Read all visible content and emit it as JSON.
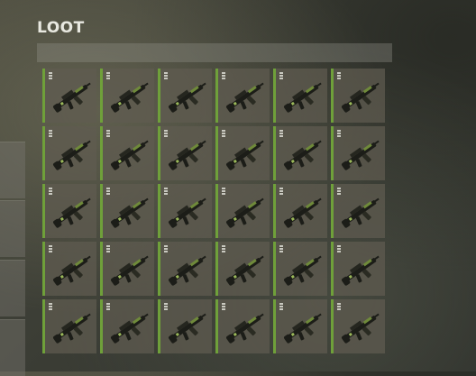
{
  "panel": {
    "title": "LOOT"
  },
  "inventory": {
    "rows": 5,
    "columns": 6,
    "slots": [
      {
        "item_icon": "assault-rifle-icon",
        "rarity_color": "#6fa03a"
      },
      {
        "item_icon": "assault-rifle-icon",
        "rarity_color": "#6fa03a"
      },
      {
        "item_icon": "assault-rifle-icon",
        "rarity_color": "#6fa03a"
      },
      {
        "item_icon": "assault-rifle-icon",
        "rarity_color": "#6fa03a"
      },
      {
        "item_icon": "assault-rifle-icon",
        "rarity_color": "#6fa03a"
      },
      {
        "item_icon": "assault-rifle-icon",
        "rarity_color": "#6fa03a"
      },
      {
        "item_icon": "assault-rifle-icon",
        "rarity_color": "#6fa03a"
      },
      {
        "item_icon": "assault-rifle-icon",
        "rarity_color": "#6fa03a"
      },
      {
        "item_icon": "assault-rifle-icon",
        "rarity_color": "#6fa03a"
      },
      {
        "item_icon": "assault-rifle-icon",
        "rarity_color": "#6fa03a"
      },
      {
        "item_icon": "assault-rifle-icon",
        "rarity_color": "#6fa03a"
      },
      {
        "item_icon": "assault-rifle-icon",
        "rarity_color": "#6fa03a"
      },
      {
        "item_icon": "assault-rifle-icon",
        "rarity_color": "#6fa03a"
      },
      {
        "item_icon": "assault-rifle-icon",
        "rarity_color": "#6fa03a"
      },
      {
        "item_icon": "assault-rifle-icon",
        "rarity_color": "#6fa03a"
      },
      {
        "item_icon": "assault-rifle-icon",
        "rarity_color": "#6fa03a"
      },
      {
        "item_icon": "assault-rifle-icon",
        "rarity_color": "#6fa03a"
      },
      {
        "item_icon": "assault-rifle-icon",
        "rarity_color": "#6fa03a"
      },
      {
        "item_icon": "assault-rifle-icon",
        "rarity_color": "#6fa03a"
      },
      {
        "item_icon": "assault-rifle-icon",
        "rarity_color": "#6fa03a"
      },
      {
        "item_icon": "assault-rifle-icon",
        "rarity_color": "#6fa03a"
      },
      {
        "item_icon": "assault-rifle-icon",
        "rarity_color": "#6fa03a"
      },
      {
        "item_icon": "assault-rifle-icon",
        "rarity_color": "#6fa03a"
      },
      {
        "item_icon": "assault-rifle-icon",
        "rarity_color": "#6fa03a"
      },
      {
        "item_icon": "assault-rifle-icon",
        "rarity_color": "#6fa03a"
      },
      {
        "item_icon": "assault-rifle-icon",
        "rarity_color": "#6fa03a"
      },
      {
        "item_icon": "assault-rifle-icon",
        "rarity_color": "#6fa03a"
      },
      {
        "item_icon": "assault-rifle-icon",
        "rarity_color": "#6fa03a"
      },
      {
        "item_icon": "assault-rifle-icon",
        "rarity_color": "#6fa03a"
      },
      {
        "item_icon": "assault-rifle-icon",
        "rarity_color": "#6fa03a"
      }
    ]
  },
  "side_tabs": {
    "count": 4
  },
  "colors": {
    "rarity_uncommon": "#6fa03a",
    "slot_background": "#5f5c50",
    "title_text": "#e8e8e0"
  }
}
